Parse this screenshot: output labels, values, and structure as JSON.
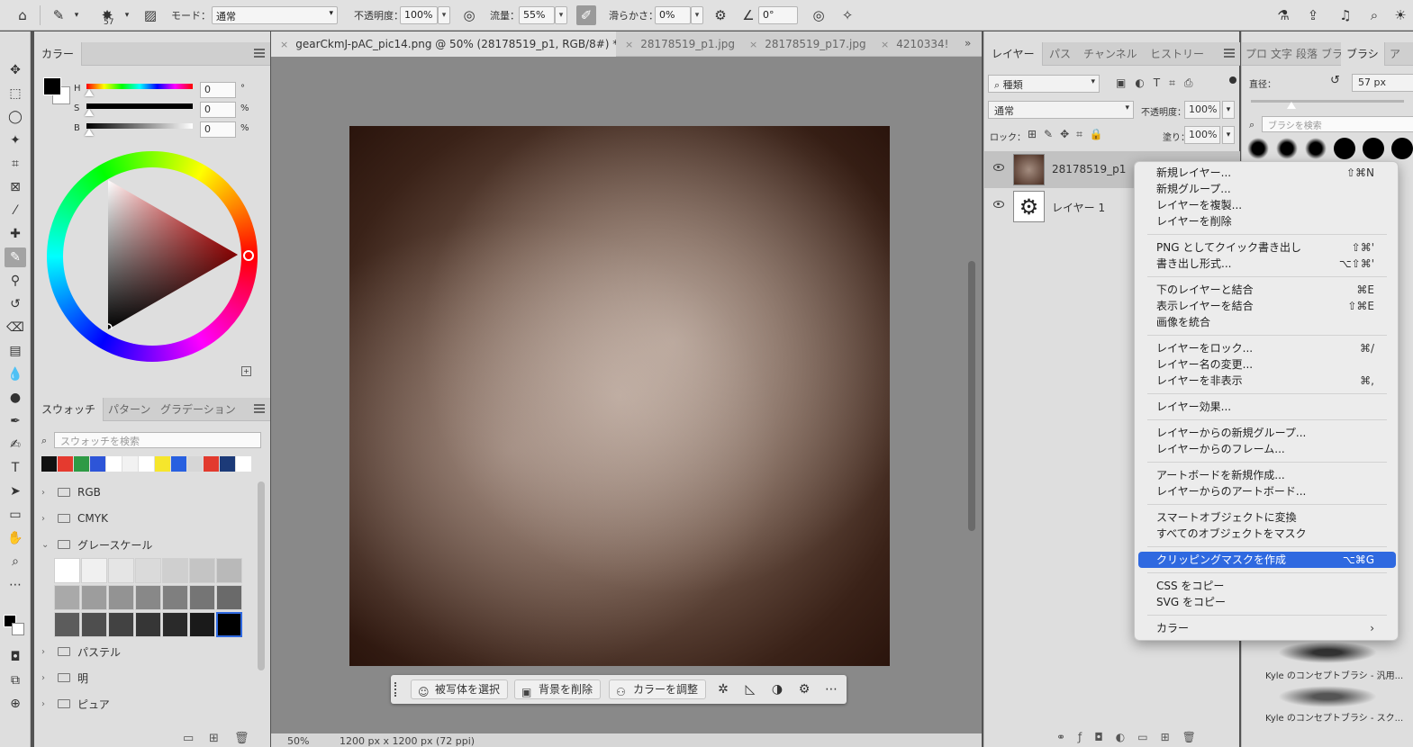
{
  "topbar": {
    "brush_size": "57",
    "mode_label": "モード：",
    "mode_value": "通常",
    "opacity_label": "不透明度：",
    "opacity_value": "100%",
    "flow_label": "流量：",
    "flow_value": "55%",
    "smoothing_label": "滑らかさ：",
    "smoothing_value": "0%",
    "angle_value": "0°"
  },
  "color_panel": {
    "tabs": [
      "カラー"
    ],
    "h_label": "H",
    "h_value": "0",
    "h_unit": "°",
    "s_label": "S",
    "s_value": "0",
    "s_unit": "%",
    "b_label": "B",
    "b_value": "0",
    "b_unit": "%"
  },
  "swatch_panel": {
    "tabs": [
      "スウォッチ",
      "パターン",
      "グラデーション"
    ],
    "search_placeholder": "スウォッチを検索",
    "swatch_colors": [
      "#111111",
      "#e53a2f",
      "#2e9a45",
      "#2d55d8",
      "#ffffff",
      "#f2f2f2",
      "#ffffff",
      "#f6e62c",
      "#2860e0",
      "#d6d6d6",
      "#e23a2e",
      "#1c3a78",
      "#ffffff"
    ],
    "folders": [
      "RGB",
      "CMYK",
      "グレースケール",
      "パステル",
      "明",
      "ピュア"
    ],
    "grayscale_rows": [
      [
        "#ffffff",
        "#f0f0f0",
        "#e5e5e5",
        "#dadada",
        "#cfcfcf",
        "#c4c4c4",
        "#b9b9b9"
      ],
      [
        "#a9a9a9",
        "#9d9d9d",
        "#939393",
        "#888888",
        "#7f7f7f",
        "#757575",
        "#6a6a6a"
      ],
      [
        "#5c5c5c",
        "#4e4e4e",
        "#424242",
        "#363636",
        "#2a2a2a",
        "#1a1a1a",
        "#000000"
      ]
    ]
  },
  "document_tabs": [
    {
      "label": "gearCkmJ-pAC_pic14.png @ 50% (28178519_p1, RGB/8#) *",
      "active": true
    },
    {
      "label": "28178519_p1.jpg",
      "active": false
    },
    {
      "label": "28178519_p17.jpg",
      "active": false
    },
    {
      "label": "4210334!",
      "active": false
    }
  ],
  "status": {
    "zoom": "50%",
    "size": "1200 px x 1200 px (72 ppi)"
  },
  "contextual_taskbar": {
    "select_subject": "被写体を選択",
    "remove_bg": "背景を削除",
    "adjust_color": "カラーを調整"
  },
  "layers_panel": {
    "tabs": [
      "レイヤー",
      "パス",
      "チャンネル",
      "ヒストリー"
    ],
    "filter_kind": "種類",
    "blend_mode": "通常",
    "opacity_label": "不透明度：",
    "opacity_value": "100%",
    "lock_label": "ロック：",
    "fill_label": "塗り：",
    "fill_value": "100%",
    "layers": [
      {
        "name": "28178519_p1"
      },
      {
        "name": "レイヤー 1"
      }
    ]
  },
  "brush_panel": {
    "tabs": [
      "プロ",
      "文字",
      "段落",
      "ブラ",
      "ブラシ",
      "ア"
    ],
    "size_label": "直径：",
    "size_value": "57 px",
    "search_placeholder": "ブラシを検索",
    "brush_names": [
      "Kyle のコンセプトブラシ - 汎用...",
      "Kyle のコンセプトブラシ - スク..."
    ]
  },
  "context_menu": {
    "groups": [
      [
        {
          "label": "新規レイヤー...",
          "shortcut": "⇧⌘N"
        },
        {
          "label": "新規グループ...",
          "shortcut": ""
        },
        {
          "label": "レイヤーを複製...",
          "shortcut": ""
        },
        {
          "label": "レイヤーを削除",
          "shortcut": ""
        }
      ],
      [
        {
          "label": "PNG としてクイック書き出し",
          "shortcut": "⇧⌘'"
        },
        {
          "label": "書き出し形式...",
          "shortcut": "⌥⇧⌘'"
        }
      ],
      [
        {
          "label": "下のレイヤーと結合",
          "shortcut": "⌘E"
        },
        {
          "label": "表示レイヤーを結合",
          "shortcut": "⇧⌘E"
        },
        {
          "label": "画像を統合",
          "shortcut": ""
        }
      ],
      [
        {
          "label": "レイヤーをロック...",
          "shortcut": "⌘/"
        },
        {
          "label": "レイヤー名の変更...",
          "shortcut": ""
        },
        {
          "label": "レイヤーを非表示",
          "shortcut": "⌘,"
        }
      ],
      [
        {
          "label": "レイヤー効果...",
          "shortcut": ""
        }
      ],
      [
        {
          "label": "レイヤーからの新規グループ...",
          "shortcut": ""
        },
        {
          "label": "レイヤーからのフレーム...",
          "shortcut": ""
        }
      ],
      [
        {
          "label": "アートボードを新規作成...",
          "shortcut": ""
        },
        {
          "label": "レイヤーからのアートボード...",
          "shortcut": ""
        }
      ],
      [
        {
          "label": "スマートオブジェクトに変換",
          "shortcut": ""
        },
        {
          "label": "すべてのオブジェクトをマスク",
          "shortcut": ""
        }
      ],
      [
        {
          "label": "クリッピングマスクを作成",
          "shortcut": "⌥⌘G",
          "highlighted": true
        }
      ],
      [
        {
          "label": "CSS をコピー",
          "shortcut": ""
        },
        {
          "label": "SVG をコピー",
          "shortcut": ""
        }
      ],
      [
        {
          "label": "カラー",
          "shortcut": "›"
        }
      ]
    ]
  }
}
